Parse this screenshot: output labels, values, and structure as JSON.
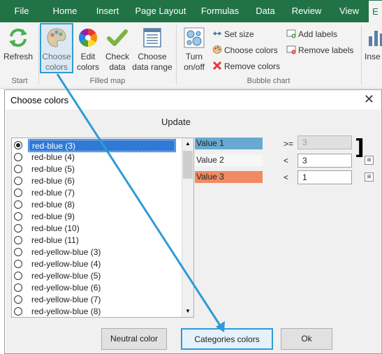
{
  "ribbon": {
    "tabs": [
      "File",
      "Home",
      "Insert",
      "Page Layout",
      "Formulas",
      "Data",
      "Review",
      "View",
      "E"
    ],
    "groups": {
      "start": "Start",
      "filled_map": "Filled map",
      "bubble_chart": "Bubble chart"
    },
    "buttons": {
      "refresh": "Refresh",
      "choose_colors": "Choose colors",
      "edit_colors": "Edit colors",
      "check_data": "Check data",
      "choose_data_range": "Choose data range",
      "turn_on_off": "Turn on/off",
      "set_size": "Set size",
      "choose_colors_bubble": "Choose colors",
      "remove_colors": "Remove colors",
      "add_labels": "Add labels",
      "remove_labels": "Remove labels",
      "insert_cut": "Inse"
    }
  },
  "dialog": {
    "title": "Choose colors",
    "close": "✕",
    "update_label": "Update",
    "palettes": [
      {
        "label": "red-blue (3)",
        "selected": true
      },
      {
        "label": "red-blue (4)",
        "selected": false
      },
      {
        "label": "red-blue (5)",
        "selected": false
      },
      {
        "label": "red-blue (6)",
        "selected": false
      },
      {
        "label": "red-blue (7)",
        "selected": false
      },
      {
        "label": "red-blue (8)",
        "selected": false
      },
      {
        "label": "red-blue (9)",
        "selected": false
      },
      {
        "label": "red-blue (10)",
        "selected": false
      },
      {
        "label": "red-blue (11)",
        "selected": false
      },
      {
        "label": "red-yellow-blue (3)",
        "selected": false
      },
      {
        "label": "red-yellow-blue (4)",
        "selected": false
      },
      {
        "label": "red-yellow-blue (5)",
        "selected": false
      },
      {
        "label": "red-yellow-blue (6)",
        "selected": false
      },
      {
        "label": "red-yellow-blue (7)",
        "selected": false
      },
      {
        "label": "red-yellow-blue (8)",
        "selected": false
      }
    ],
    "values": [
      {
        "label": "Value 1",
        "color": "#67a9cf",
        "operator": ">=",
        "threshold": "3",
        "disabled": true
      },
      {
        "label": "Value 2",
        "color": "#f7f7f7",
        "operator": "<",
        "threshold": "3",
        "disabled": false
      },
      {
        "label": "Value 3",
        "color": "#ef8a62",
        "operator": "<",
        "threshold": "1",
        "disabled": false
      }
    ],
    "buttons": {
      "neutral": "Neutral color",
      "categories": "Categories colors",
      "ok": "Ok"
    }
  },
  "colors": {
    "accent_highlight": "#2e9bd6",
    "excel_green": "#217346",
    "selection_blue": "#2f7ad6"
  }
}
